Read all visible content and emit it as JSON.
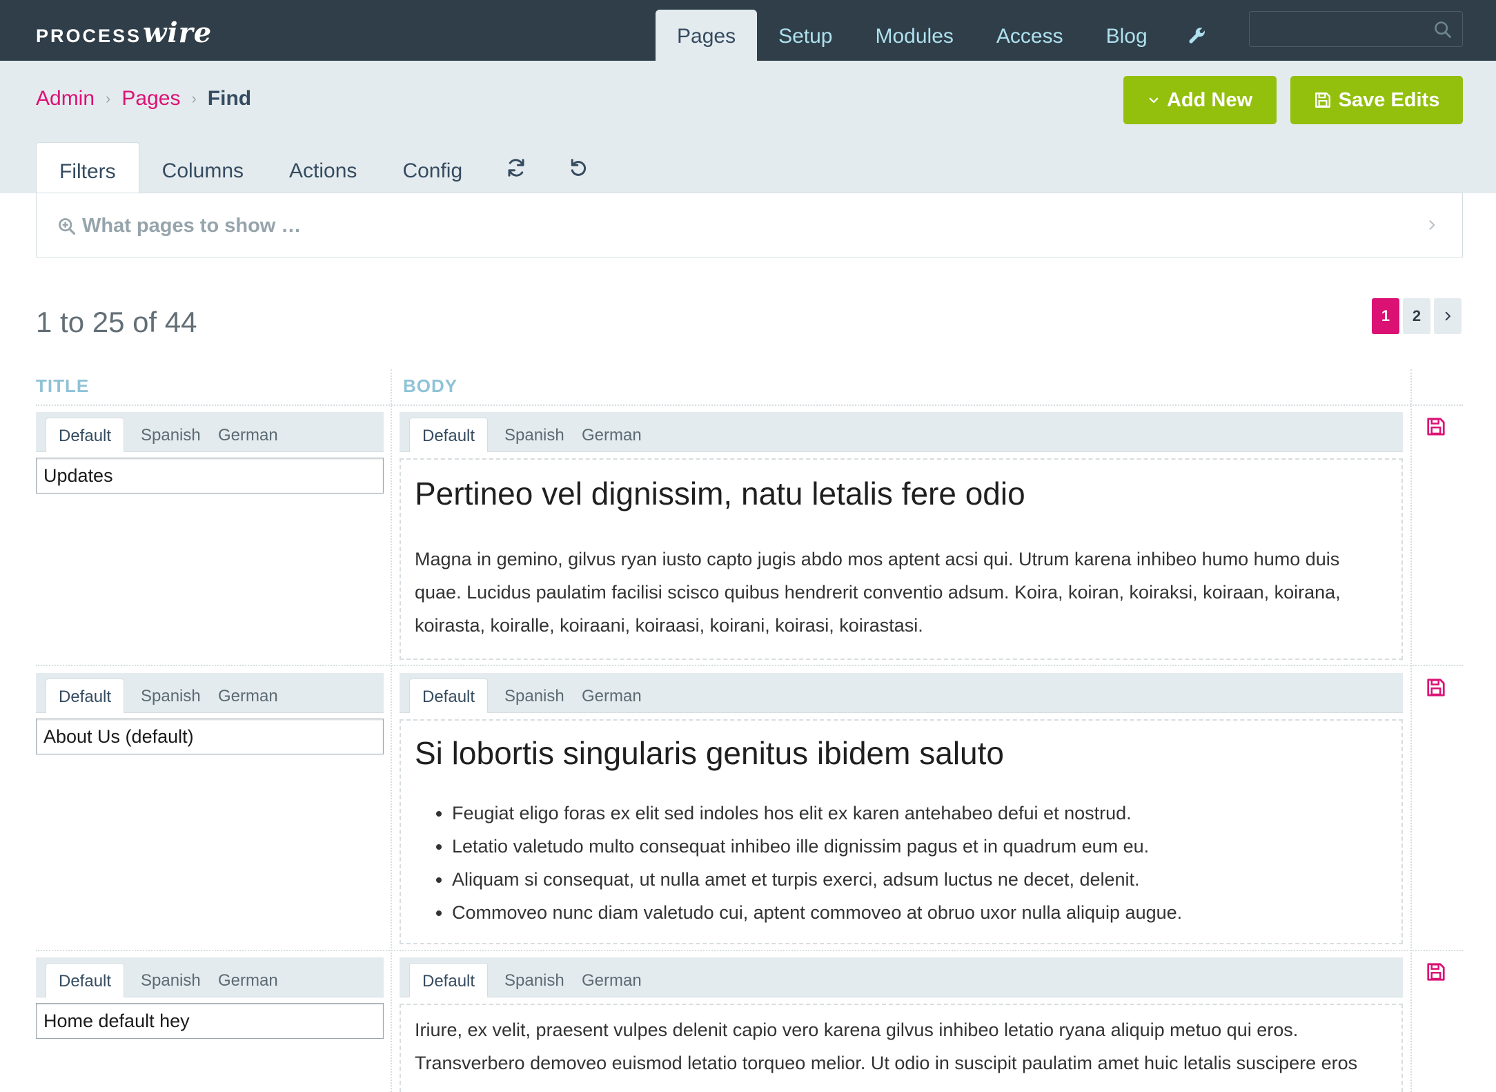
{
  "brand": {
    "logo_part1": "PROCESS",
    "logo_part2": "wire"
  },
  "nav": {
    "items": [
      "Pages",
      "Setup",
      "Modules",
      "Access",
      "Blog"
    ],
    "active": "Pages"
  },
  "search": {
    "placeholder": ""
  },
  "breadcrumb": {
    "items": [
      "Admin",
      "Pages"
    ],
    "current": "Find"
  },
  "buttons": {
    "add_new": "Add New",
    "save_edits": "Save Edits"
  },
  "tabs": {
    "items": [
      "Filters",
      "Columns",
      "Actions",
      "Config"
    ],
    "active": "Filters"
  },
  "filters": {
    "placeholder": "What pages to show …"
  },
  "results": {
    "summary": "1 to 25 of 44"
  },
  "pagination": {
    "pages": [
      "1",
      "2"
    ],
    "current": "1"
  },
  "table": {
    "columns": [
      "TITLE",
      "BODY"
    ],
    "languages": [
      "Default",
      "Spanish",
      "German"
    ],
    "rows": [
      {
        "title": "Updates",
        "body": {
          "heading": "Pertineo vel dignissim, natu letalis fere odio",
          "paragraph": "Magna in gemino, gilvus ryan iusto capto jugis abdo mos aptent acsi qui. Utrum karena inhibeo humo humo duis quae. Lucidus paulatim facilisi scisco quibus hendrerit conventio adsum. Koira, koiran, koiraksi, koiraan, koirana, koirasta, koiralle, koiraani, koiraasi, koirani, koirasi, koirastasi."
        }
      },
      {
        "title": "About Us (default)",
        "body": {
          "heading": "Si lobortis singularis genitus ibidem saluto",
          "list": [
            "Feugiat eligo foras ex elit sed indoles hos elit ex karen antehabeo defui et nostrud.",
            "Letatio valetudo multo consequat inhibeo ille dignissim pagus et in quadrum eum eu.",
            "Aliquam si consequat, ut nulla amet et turpis exerci, adsum luctus ne decet, delenit.",
            "Commoveo nunc diam valetudo cui, aptent commoveo at obruo uxor nulla aliquip augue."
          ]
        }
      },
      {
        "title": "Home default hey",
        "body": {
          "paragraph": "Iriure, ex velit, praesent vulpes delenit capio vero karena gilvus inhibeo letatio ryana aliquip metuo qui eros. Transverbero demoveo euismod letatio torqueo melior. Ut odio in suscipit paulatim amet huic letalis suscipere eros"
        }
      }
    ]
  },
  "colors": {
    "masthead": "#2f3e48",
    "band": "#e4ebee",
    "accent": "#db1174",
    "button": "#93bf0d",
    "nav_link": "#aee0ef",
    "column_header": "#8fc3d6"
  },
  "icons": {
    "search": "search-icon",
    "wrench": "wrench-icon",
    "chevron": "chevron-down-icon",
    "save": "save-icon",
    "refresh": "refresh-icon",
    "reset": "reset-icon",
    "zoom": "zoom-in-icon",
    "next": "chevron-right-icon"
  }
}
